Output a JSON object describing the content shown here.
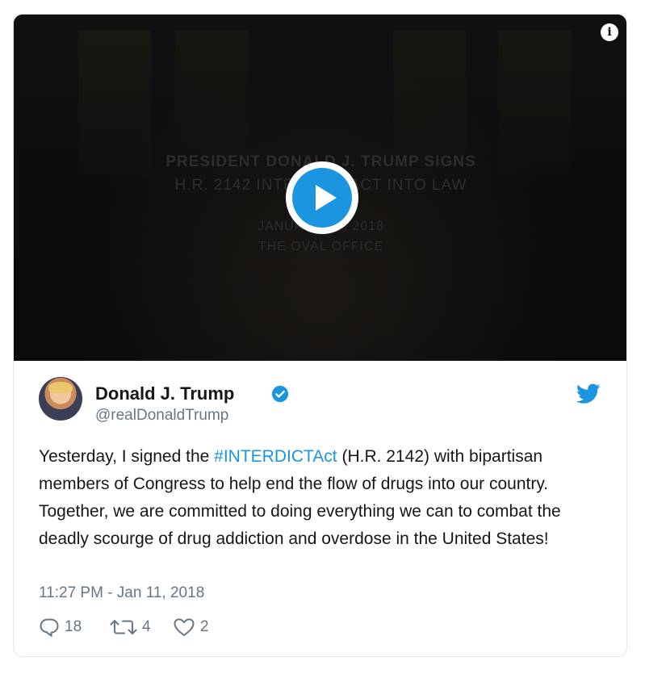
{
  "video": {
    "overlay_line1": "PRESIDENT DONALD J. TRUMP SIGNS",
    "overlay_line2": "H.R. 2142 INTERDICT ACT INTO LAW",
    "overlay_line3": "JANUARY 10, 2018",
    "overlay_line4": "THE OVAL OFFICE",
    "info_icon": "info-icon",
    "play_icon": "play-icon"
  },
  "author": {
    "name": "Donald J. Trump",
    "handle": "@realDonaldTrump",
    "verified_icon": "verified-badge-icon",
    "platform_icon": "twitter-bird-icon"
  },
  "tweet": {
    "text_before": "Yesterday, I signed the ",
    "hashtag": "#INTERDICTAct",
    "text_after": " (H.R. 2142) with bipartisan members of Congress to help end the flow of drugs into our country. Together, we are committed to doing everything we can to combat the deadly scourge of drug addiction and overdose in the United States!",
    "timestamp": "11:27 PM - Jan 11, 2018"
  },
  "actions": {
    "reply_count": "18",
    "retweet_count": "4",
    "like_count": "2"
  },
  "colors": {
    "accent": "#1b95e0",
    "muted": "#657786",
    "text": "#14171a"
  }
}
